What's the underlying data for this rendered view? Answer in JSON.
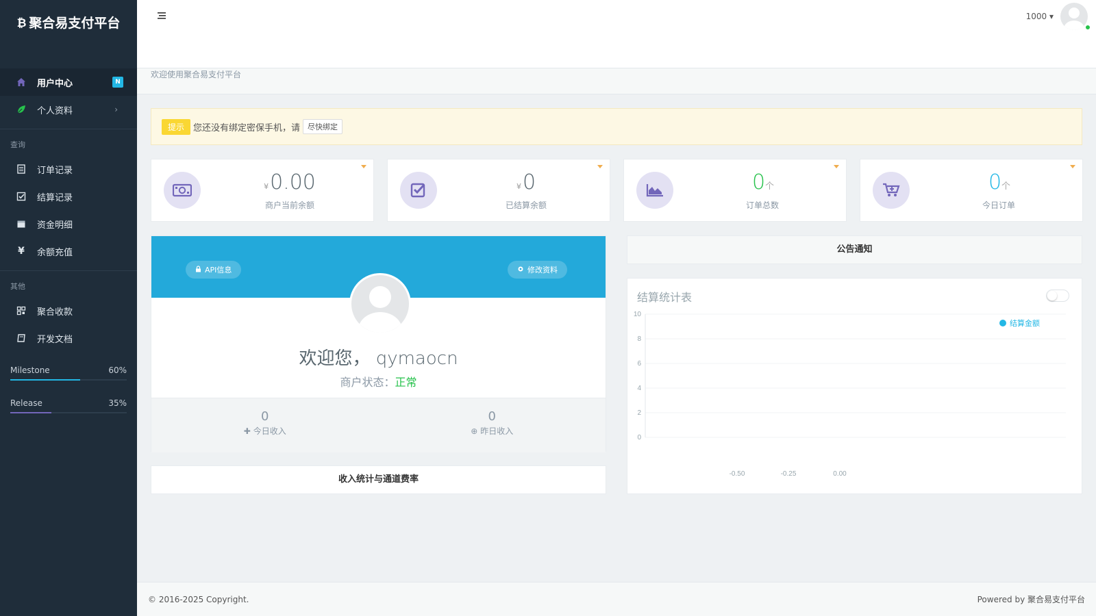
{
  "brand": {
    "title": "聚合易支付平台"
  },
  "sidebar": {
    "items_top": [
      {
        "label": "用户中心",
        "badge": "N"
      },
      {
        "label": "个人资料",
        "chevron": "›"
      }
    ],
    "section_query": "查询",
    "items_query": [
      {
        "label": "订单记录"
      },
      {
        "label": "结算记录"
      },
      {
        "label": "资金明细"
      },
      {
        "label": "余额充值"
      }
    ],
    "section_other": "其他",
    "items_other": [
      {
        "label": "聚合收款"
      },
      {
        "label": "开发文档"
      }
    ],
    "progress": [
      {
        "label": "Milestone",
        "percent_label": "60%",
        "value": 60,
        "color": "#23b7e5"
      },
      {
        "label": "Release",
        "percent_label": "35%",
        "value": 35,
        "color": "#7266ba"
      }
    ]
  },
  "topbar": {
    "user": "1000"
  },
  "welcome_bar": "欢迎使用聚合易支付平台",
  "alert": {
    "tag": "提示",
    "text": "您还没有绑定密保手机，请",
    "button": "尽快绑定"
  },
  "stats": [
    {
      "currency": "¥",
      "value": "0.00",
      "unit": "",
      "label": "商户当前余额"
    },
    {
      "currency": "¥",
      "value": "0",
      "unit": "",
      "label": "已结算余额"
    },
    {
      "currency": "",
      "value": "0",
      "unit": "个",
      "label": "订单总数"
    },
    {
      "currency": "",
      "value": "0",
      "unit": "个",
      "label": "今日订单"
    }
  ],
  "profile": {
    "api_button": "API信息",
    "edit_button": "修改资料",
    "greeting": "欢迎您，",
    "username": "qymaocn",
    "status_label": "商户状态：",
    "status_value": "正常",
    "today_income_value": "0",
    "today_income_label": "今日收入",
    "yesterday_income_value": "0",
    "yesterday_income_label": "昨日收入"
  },
  "income_title": "收入统计与通道费率",
  "notice_title": "公告通知",
  "chart_data": {
    "type": "line",
    "title": "结算统计表",
    "series": [
      {
        "name": "结算金额",
        "values": []
      }
    ],
    "y_ticks": [
      "10",
      "8",
      "6",
      "4",
      "2",
      "0"
    ],
    "x_ticks": [
      "-0.50",
      "-0.25",
      "0.00"
    ],
    "ylim": [
      0,
      10
    ],
    "legend_position": "top-right",
    "grid": true,
    "color": "#23b7e5"
  },
  "footer": {
    "copyright": "© 2016-2025 Copyright.",
    "powered": "Powered by 聚合易支付平台"
  },
  "colors": {
    "sidebar": "#1f2d3a",
    "accent": "#23b7e5",
    "success": "#27c24c",
    "warning": "#fad733"
  }
}
